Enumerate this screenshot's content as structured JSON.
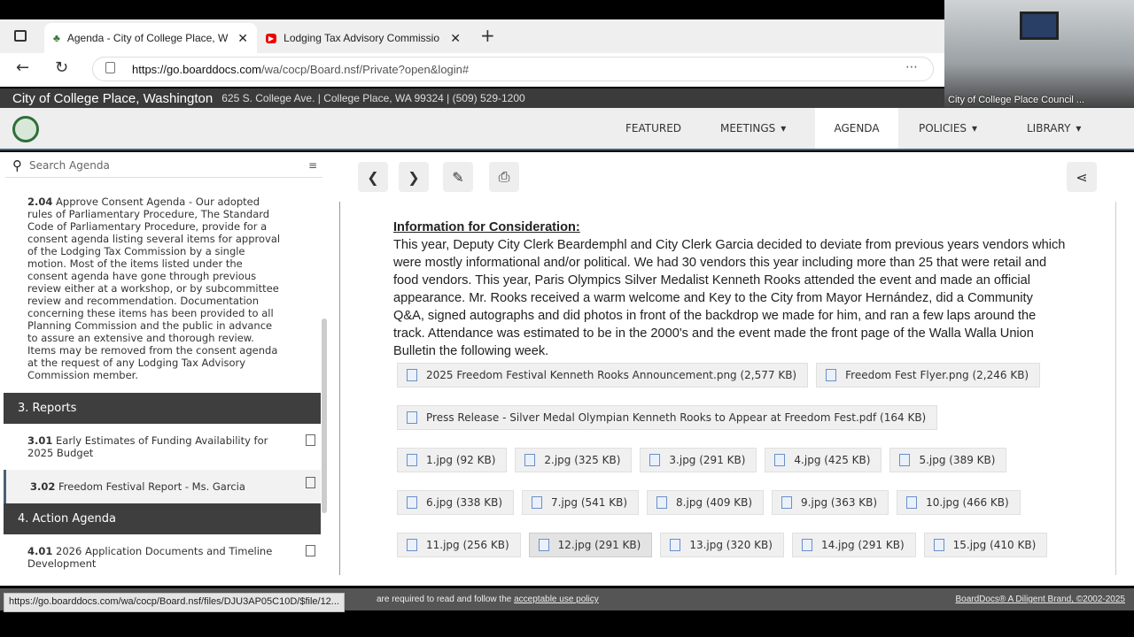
{
  "browser": {
    "tabs": [
      {
        "label": "Agenda - City of College Place, W",
        "icon": "tree-icon"
      },
      {
        "label": "Lodging Tax Advisory Commissio",
        "icon": "youtube-icon"
      }
    ],
    "url_host": "https://go.boarddocs.com",
    "url_path": "/wa/cocp/Board.nsf/Private?open&login#"
  },
  "site": {
    "title": "City of College Place, Washington",
    "address": "625 S. College Ave. | College Place, WA 99324 | (509) 529-1200"
  },
  "nav": [
    {
      "label": "FEATURED"
    },
    {
      "label": "MEETINGS",
      "chev": "▾"
    },
    {
      "label": "AGENDA"
    },
    {
      "label": "POLICIES",
      "chev": "▾"
    },
    {
      "label": "LIBRARY",
      "chev": "▾"
    }
  ],
  "sidebar": {
    "search_placeholder": "Search Agenda",
    "item_204_num": "2.04",
    "item_204_text": "Approve Consent Agenda - Our adopted rules of Parliamentary Procedure, The Standard Code of Parliamentary Procedure, provide for a consent agenda listing several items for approval of the Lodging Tax Commission by a single motion. Most of the items listed under the consent agenda have gone through previous review either at a workshop, or by subcommittee review and recommendation. Documentation concerning these items has been provided to all Planning Commission and the public in advance to assure an extensive and thorough review. Items may be removed from the consent agenda at the request of any Lodging Tax Advisory Commission member.",
    "sec3": "3. Reports",
    "item_301_num": "3.01",
    "item_301_text": "Early Estimates of Funding Availability for 2025 Budget",
    "item_302_num": "3.02",
    "item_302_text": "Freedom Festival Report - Ms. Garcia",
    "sec4": "4. Action Agenda",
    "item_401_num": "4.01",
    "item_401_text": "2026 Application Documents and Timeline Development"
  },
  "content": {
    "heading": "Information for Consideration:",
    "body": "This year, Deputy City Clerk Beardemphl and City Clerk Garcia decided to deviate from previous years vendors which were mostly informational and/or political. We had 30 vendors this year including more than 25 that were retail and food vendors. This year, Paris Olympics Silver Medalist Kenneth Rooks attended the event and made an official appearance. Mr. Rooks received a warm welcome and Key to the City from Mayor Hernández, did a Community Q&A, signed autographs and did photos in front of the backdrop we made for him, and ran a few laps around the track. Attendance was estimated to be in the 2000's and the event made the front page of the Walla Walla Union Bulletin the following week.",
    "files": [
      "2025 Freedom Festival Kenneth Rooks Announcement.png (2,577 KB)",
      "Freedom Fest Flyer.png (2,246 KB)",
      "Press Release - Silver Medal Olympian Kenneth Rooks to Appear at Freedom Fest.pdf (164 KB)",
      "1.jpg (92 KB)",
      "2.jpg (325 KB)",
      "3.jpg (291 KB)",
      "4.jpg (425 KB)",
      "5.jpg (389 KB)",
      "6.jpg (338 KB)",
      "7.jpg (541 KB)",
      "8.jpg (409 KB)",
      "9.jpg (363 KB)",
      "10.jpg (466 KB)",
      "11.jpg (256 KB)",
      "12.jpg (291 KB)",
      "13.jpg (320 KB)",
      "14.jpg (291 KB)",
      "15.jpg (410 KB)"
    ]
  },
  "footer": {
    "text": "are required to read and follow the",
    "link": "acceptable use policy",
    "brand": "BoardDocs® A Diligent Brand, ©2002-2025"
  },
  "status_url": "https://go.boarddocs.com/wa/cocp/Board.nsf/files/DJU3AP05C10D/$file/12...",
  "video": {
    "label": "City of College Place Council ..."
  }
}
